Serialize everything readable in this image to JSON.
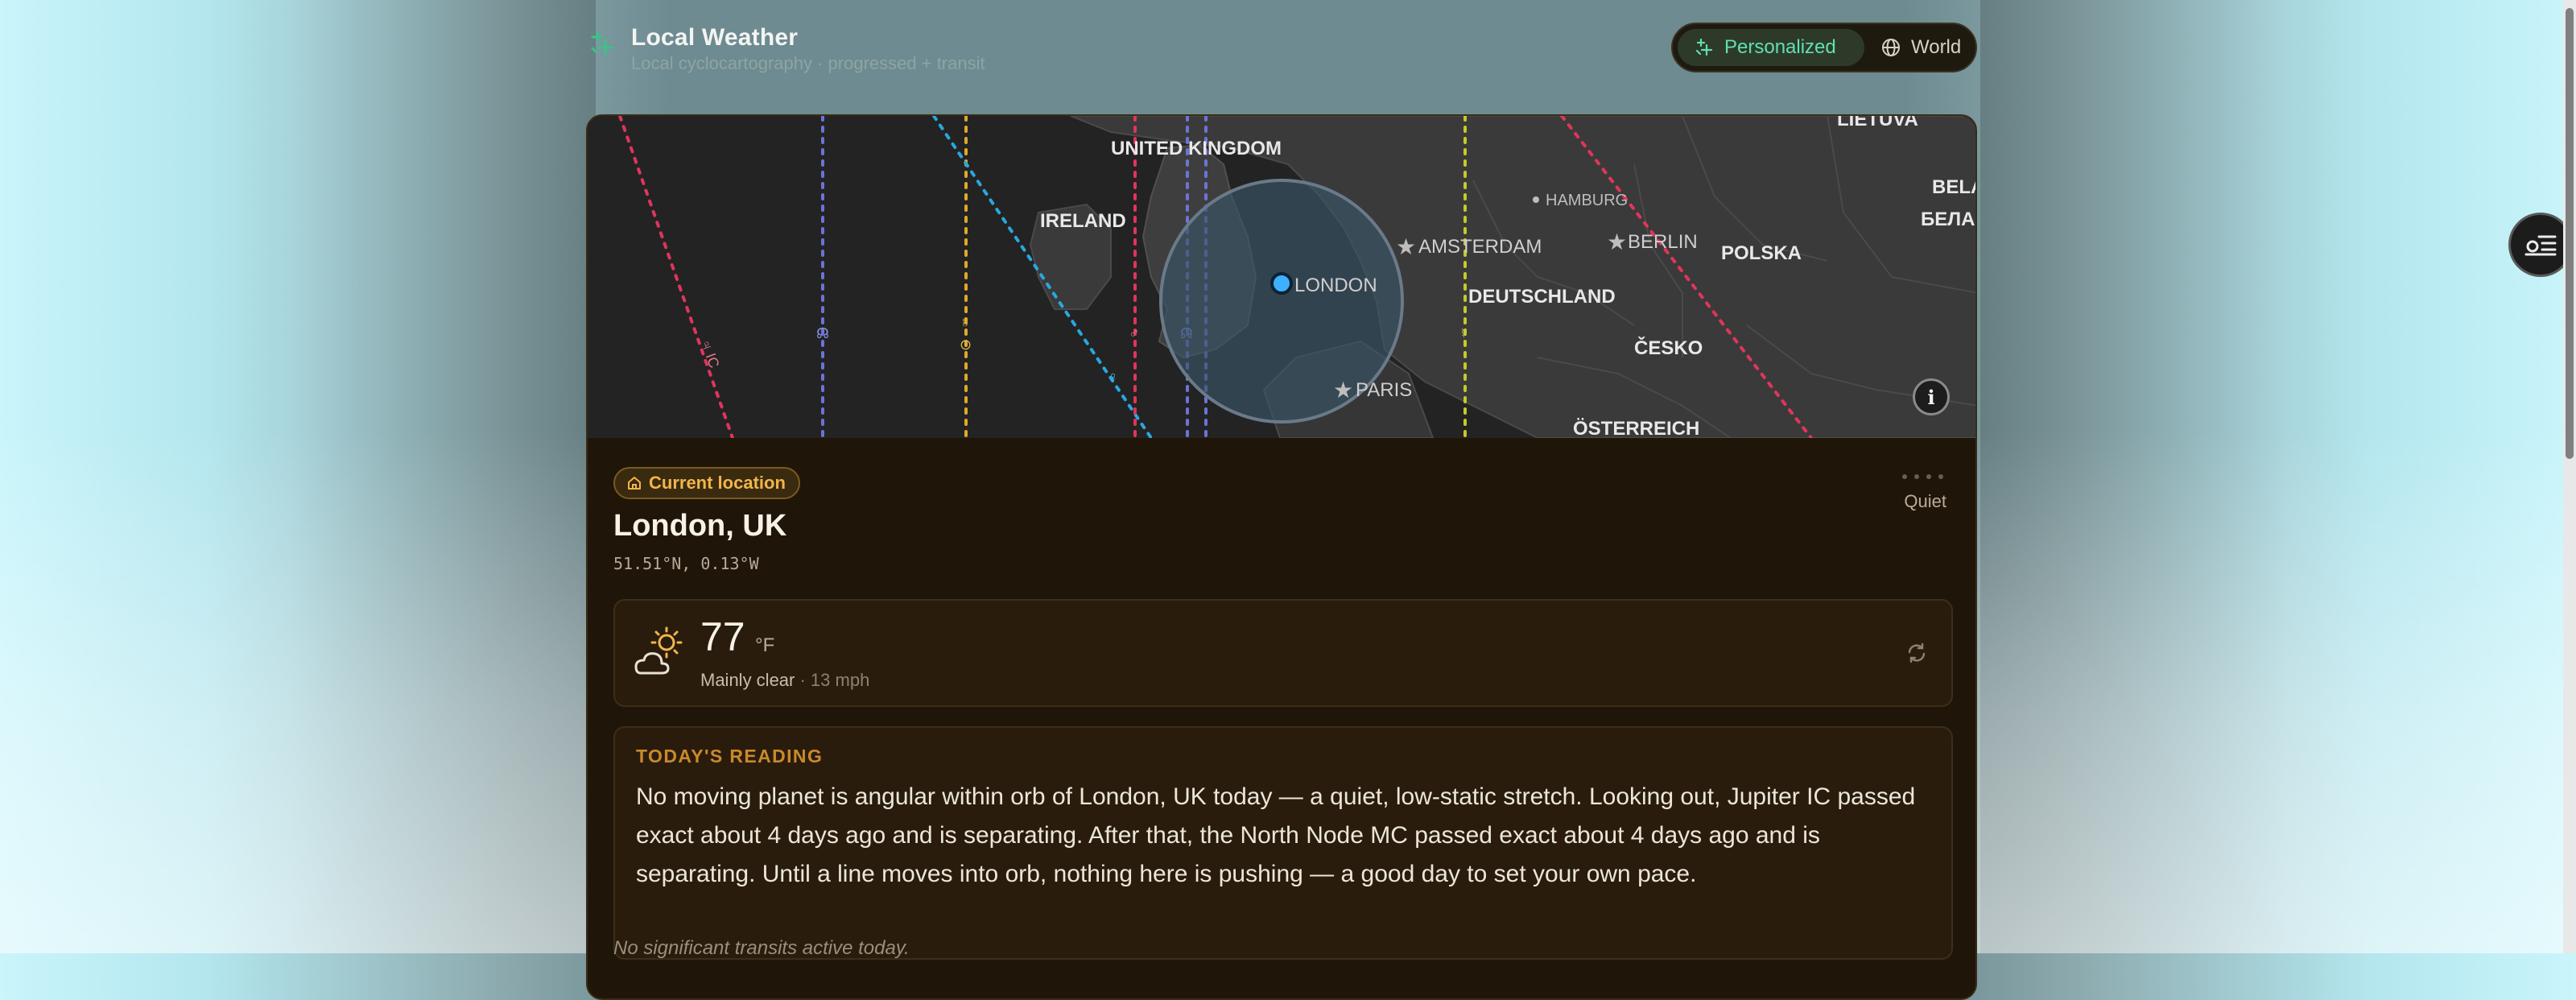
{
  "header": {
    "title": "Local Weather",
    "subtitle": "Local cyclocartography · progressed + transit",
    "modes": [
      {
        "label": "Personalized",
        "active": true
      },
      {
        "label": "World",
        "active": false
      }
    ]
  },
  "map": {
    "labels": [
      "UNITED KINGDOM",
      "IRELAND",
      "LONDON",
      "AMSTERDAM",
      "HAMBURG",
      "BERLIN",
      "POLSKA",
      "DEUTSCHLAND",
      "ČESKO",
      "PARIS",
      "ÖSTERREICH",
      "LIETUVA",
      "BELA",
      "БЕЛА"
    ],
    "line_colors": [
      "#e0355a",
      "#6b74d8",
      "#e0a82a",
      "#2aa6e0",
      "#c8c82a"
    ],
    "info_label": "i"
  },
  "location": {
    "badge": "Current location",
    "city": "London, UK",
    "coords": "51.51°N, 0.13°W",
    "status": "Quiet"
  },
  "weather": {
    "temp": "77",
    "unit": "°F",
    "condition": "Mainly clear",
    "wind": " · 13 mph",
    "icon": "partly-sunny-icon"
  },
  "reading": {
    "title": "TODAY'S READING",
    "text": "No moving planet is angular within orb of London, UK today — a quiet, low-static stretch. Looking out, Jupiter IC passed exact about 4 days ago and is separating. After that, the North Node MC passed exact about 4 days ago and is separating. Until a line moves into orb, nothing here is pushing — a good day to set your own pace."
  },
  "footer_note": "No significant transits active today."
}
